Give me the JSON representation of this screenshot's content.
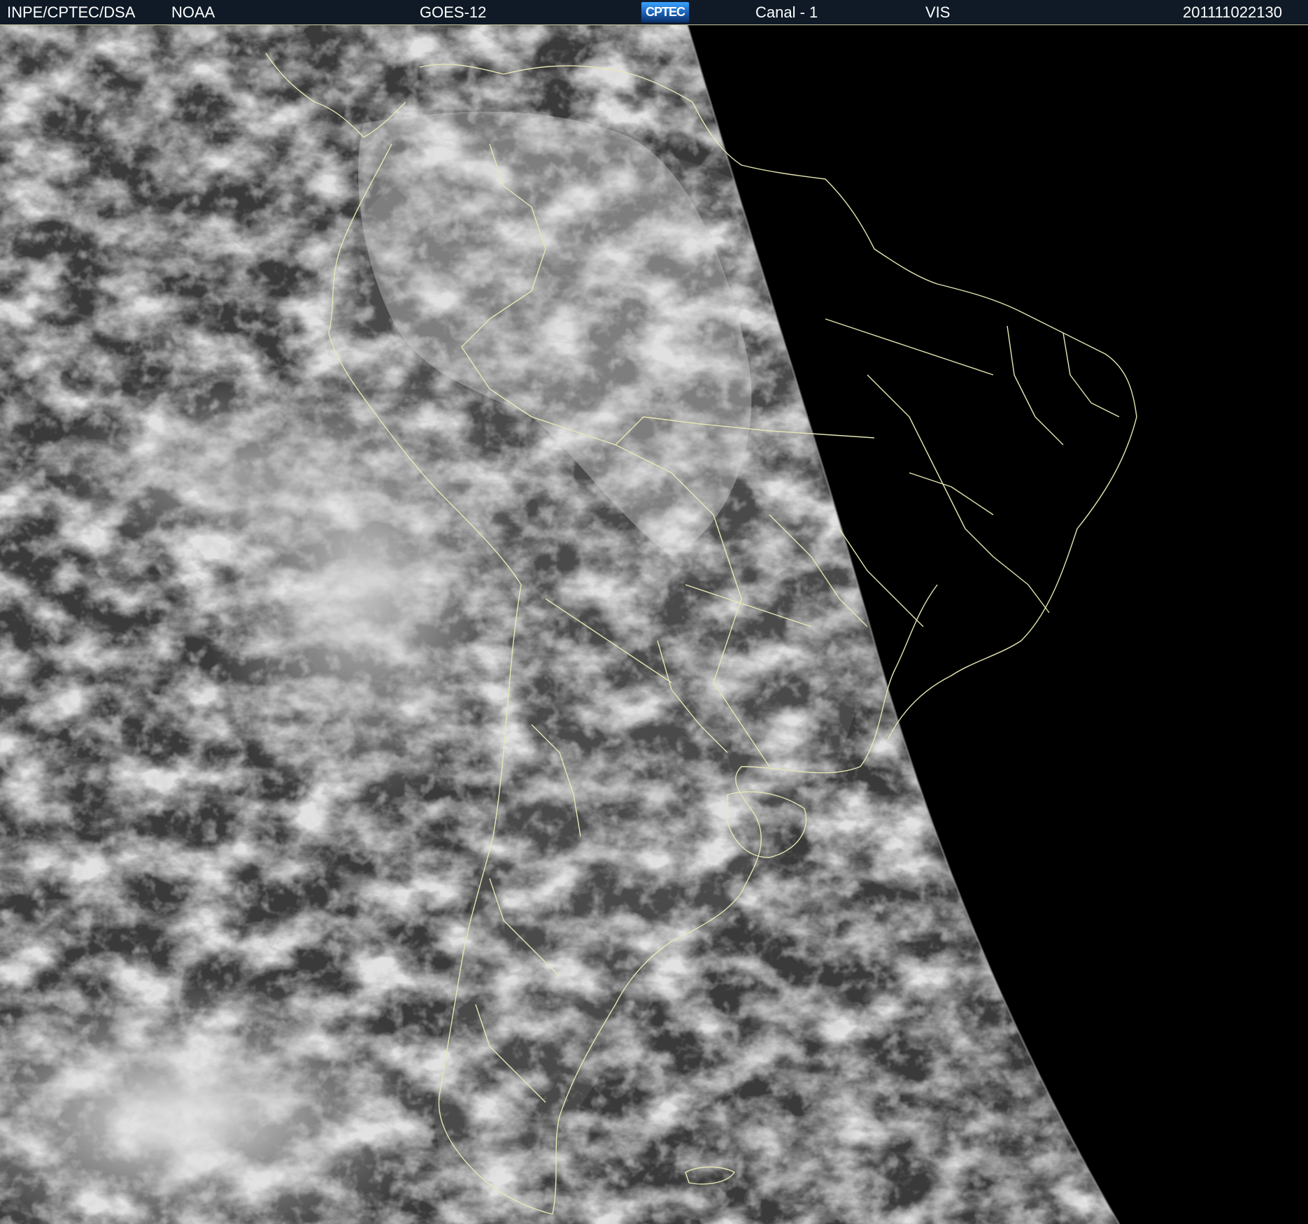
{
  "header": {
    "organization": "INPE/CPTEC/DSA",
    "agency": "NOAA",
    "satellite": "GOES-12",
    "logo_text": "CPTEC",
    "channel": "Canal - 1",
    "band": "VIS",
    "timestamp": "201111022130"
  },
  "image": {
    "subject": "visible satellite imagery of South America",
    "outline_color": "#e6e6b4",
    "night_color": "#000000",
    "cloud_color": "#d8d8d8",
    "ocean_color": "#3c3c3c"
  }
}
